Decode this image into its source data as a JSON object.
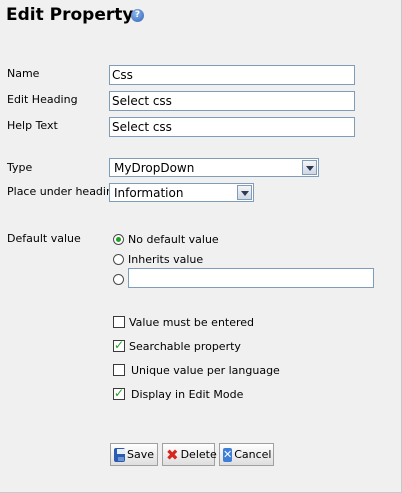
{
  "header": {
    "title": "Edit Property",
    "help_icon": "help-icon",
    "help_symbol": "?"
  },
  "fields": {
    "name": {
      "label": "Name",
      "value": "Css"
    },
    "edit_heading": {
      "label": "Edit Heading",
      "value": "Select css"
    },
    "help_text": {
      "label": "Help Text",
      "value": "Select css"
    }
  },
  "type": {
    "label": "Type",
    "value": "MyDropDown"
  },
  "place_under_heading": {
    "label": "Place under heading",
    "value": "Information"
  },
  "default_value": {
    "label": "Default value",
    "options": [
      "No default value",
      "Inherits value"
    ],
    "selected": "No default value",
    "custom_value": ""
  },
  "checkboxes": [
    {
      "label": "Value must be entered",
      "checked": false
    },
    {
      "label": "Searchable property",
      "checked": true
    },
    {
      "label": "Unique value per language",
      "checked": false
    },
    {
      "label": "Display in Edit Mode",
      "checked": true
    }
  ],
  "buttons": {
    "save": {
      "label": "Save",
      "icon": "save-icon"
    },
    "delete": {
      "label": "Delete",
      "icon": "delete-icon",
      "symbol": "✖"
    },
    "cancel": {
      "label": "Cancel",
      "icon": "cancel-icon",
      "symbol": "✕"
    }
  },
  "colors": {
    "check_green": "#21a121",
    "input_border": "#7f9db9",
    "background": "#f0f0f0"
  }
}
